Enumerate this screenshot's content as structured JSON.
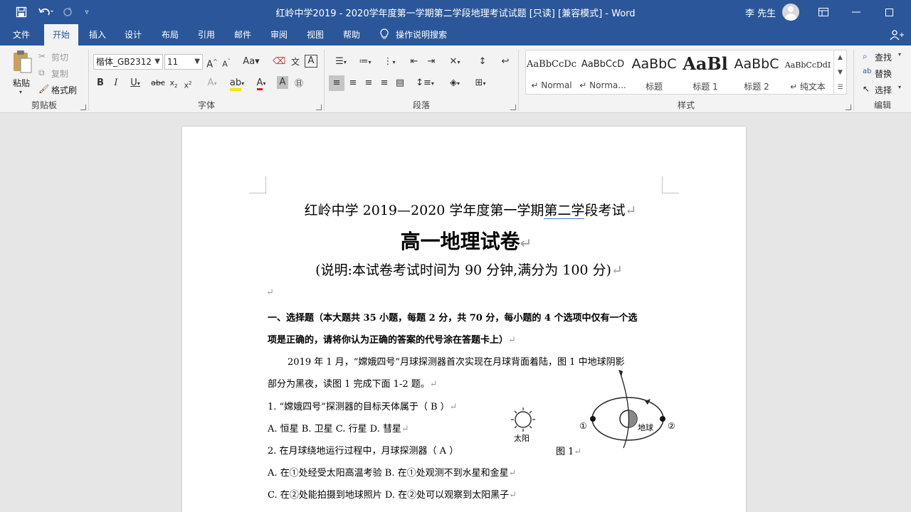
{
  "titlebar": {
    "title": "红岭中学2019 - 2020学年度第一学期第二学段地理考试试题 [只读] [兼容模式]  -  Word",
    "user": "李 先生"
  },
  "tabs": [
    "文件",
    "开始",
    "插入",
    "设计",
    "布局",
    "引用",
    "邮件",
    "审阅",
    "视图",
    "帮助"
  ],
  "tell_me": "操作说明搜索",
  "clipboard": {
    "paste": "粘贴",
    "cut": "剪切",
    "copy": "复制",
    "format_painter": "格式刷",
    "label": "剪贴板"
  },
  "font": {
    "name": "楷体_GB2312",
    "size": "11",
    "label": "字体"
  },
  "paragraph": {
    "label": "段落"
  },
  "styles": {
    "label": "样式",
    "items": [
      {
        "preview": "AaBbCcDc",
        "name": "↵ Normal"
      },
      {
        "preview": "AaBbCcD",
        "name": "↵ Norma..."
      },
      {
        "preview": "AaBbC",
        "name": "标题"
      },
      {
        "preview": "AaBl",
        "name": "标题 1"
      },
      {
        "preview": "AaBbC",
        "name": "标题 2"
      },
      {
        "preview": "AaBbCcDdI",
        "name": "↵ 纯文本"
      }
    ]
  },
  "editing": {
    "find": "查找",
    "replace": "替换",
    "select": "选择",
    "label": "编辑"
  },
  "document": {
    "school_line_a": "红岭中学 2019—2020 学年度第一学期",
    "school_line_b": "第二学",
    "school_line_c": "段考试",
    "title": "高一地理试卷",
    "note": "(说明:本试卷考试时间为 90 分钟,满分为 100 分)",
    "section_line1": "一、选择题（本大题共 35 小题，每题 2 分，共 70 分，每小题的 4 个选项中仅有一个选",
    "section_line2": "项是正确的，请将你认为正确的答案的代号涂在答题卡上）",
    "intro_line1": "2019 年 1 月，“嫦娥四号”月球探测器首次实现在月球背面着陆，图 1 中地球阴影",
    "intro_line2": "部分为黑夜，读图 1 完成下面 1-2 题。",
    "q1": "1. “嫦娥四号”探测器的目标天体属于（ B ）",
    "q1_options": "A. 恒星    B. 卫星    C. 行星    D. 彗星",
    "q2": "2. 在月球绕地运行过程中，月球探测器（  A ）",
    "q2_ab": "A. 在①处经受太阳高温考验   B. 在①处观测不到水星和金星",
    "q2_cd": "C. 在②处能拍摄到地球照片   D. 在②处可以观察到太阳黑子",
    "figure": {
      "sun_label": "太阳",
      "earth_label": "地球",
      "pos1": "①",
      "pos2": "②",
      "caption": "图 1"
    }
  }
}
